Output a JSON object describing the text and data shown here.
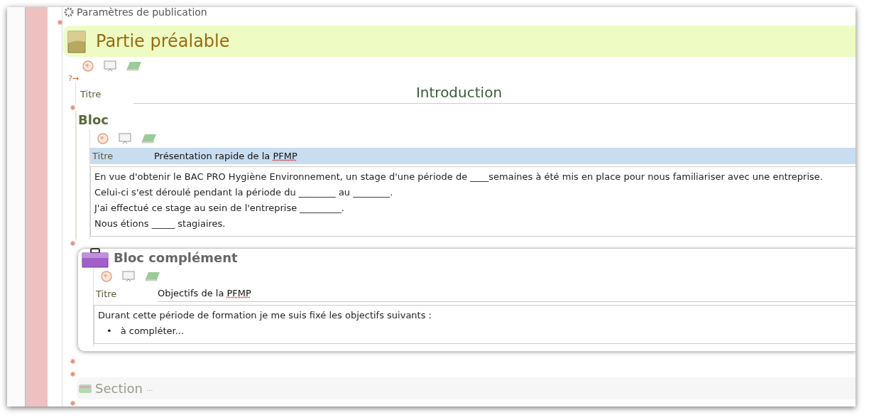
{
  "publication_settings": {
    "label": "Paramètres de publication"
  },
  "part": {
    "title": "Partie préalable",
    "help_marker": "?→",
    "title_label": "Titre",
    "title_value": "Introduction"
  },
  "blocks": [
    {
      "kind": "plain",
      "heading": "Bloc",
      "title_label": "Titre",
      "selected": true,
      "title_parts": [
        {
          "text": "Présentation rapide de la ",
          "misspelled": false
        },
        {
          "text": "PFMP",
          "misspelled": true
        }
      ],
      "paragraphs": [
        "En vue d'obtenir le BAC PRO Hygiène Environnement, un stage d'une période de ____semaines à été mis en place pour nous familiariser avec une entreprise.",
        "Celui-ci s'est déroulé pendant la période du ________ au ________.",
        "J'ai effectué ce stage au sein de l'entreprise _________.",
        "Nous étions _____ stagiaires."
      ]
    },
    {
      "kind": "complement",
      "heading": "Bloc complément",
      "title_label": "Titre",
      "selected": false,
      "title_parts": [
        {
          "text": "Objectifs de la ",
          "misspelled": false
        },
        {
          "text": "PFMP",
          "misspelled": true
        }
      ],
      "paragraphs": [
        "Durant cette période de formation je me suis fixé les objectifs suivants :"
      ],
      "bullets": [
        {
          "marker": "•",
          "text": "à compléter..."
        }
      ]
    }
  ],
  "section": {
    "label": "Section",
    "more": "..."
  }
}
